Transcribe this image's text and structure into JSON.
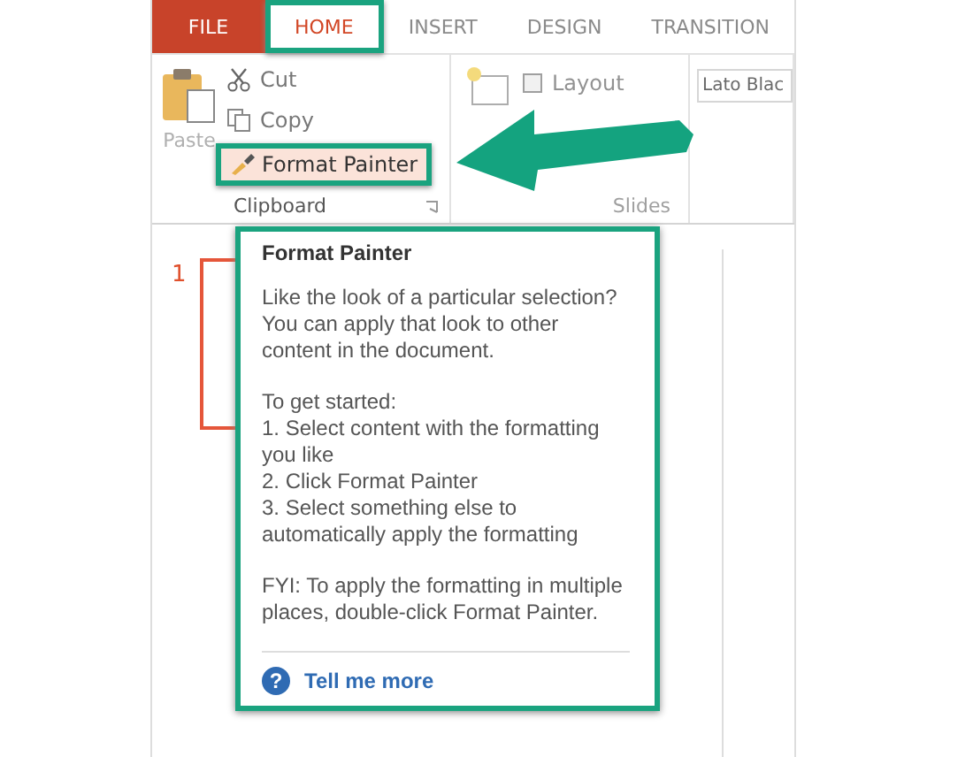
{
  "tabs": [
    {
      "label": "FILE",
      "kind": "file",
      "selected": false,
      "highlighted": false
    },
    {
      "label": "HOME",
      "kind": "tab",
      "selected": true,
      "highlighted": true
    },
    {
      "label": "INSERT",
      "kind": "tab",
      "selected": false,
      "highlighted": false
    },
    {
      "label": "DESIGN",
      "kind": "tab",
      "selected": false,
      "highlighted": false
    },
    {
      "label": "TRANSITION",
      "kind": "tab",
      "selected": false,
      "highlighted": false
    }
  ],
  "clipboard": {
    "paste": "Paste",
    "cut": "Cut",
    "copy": "Copy",
    "format_painter": {
      "label": "Format Painter",
      "highlighted": true
    },
    "label": "Clipboard"
  },
  "slides_group": {
    "layout": "Layout",
    "label": "Slides"
  },
  "font_group": {
    "font_name": "Lato Blac"
  },
  "slide_pane": {
    "number": "1"
  },
  "tooltip": {
    "title": "Format Painter",
    "intro": "Like the look of a particular selection? You can apply that look to other content in the document.",
    "steps_heading": "To get started:",
    "steps": [
      "1. Select content with the formatting you like",
      "2. Click Format Painter",
      "3. Select something else to automatically apply the formatting"
    ],
    "note": "FYI: To apply the formatting in multiple places, double-click Format Painter.",
    "help_glyph": "?",
    "link": "Tell me more"
  }
}
